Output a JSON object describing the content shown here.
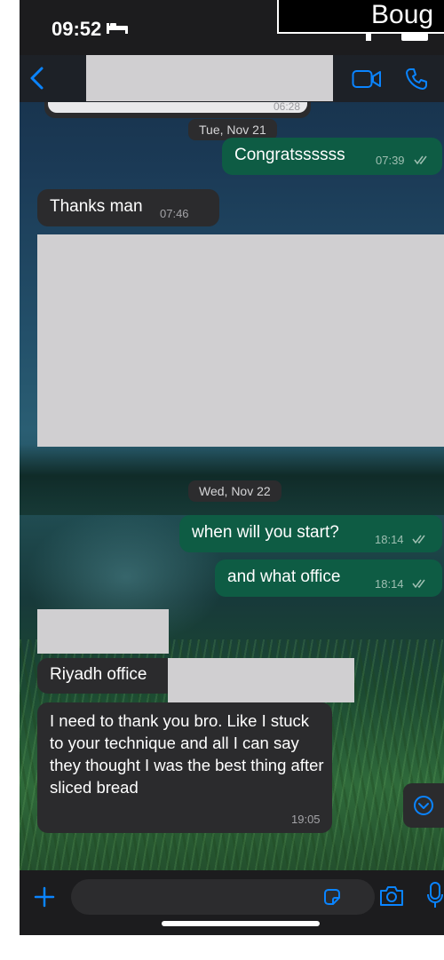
{
  "status_bar": {
    "time": "09:52",
    "caption_text": "Boug"
  },
  "header": {
    "contact_name": ""
  },
  "conversation": {
    "partial_time": "06:28",
    "date_1": "Tue, Nov 21",
    "msg_congrats": {
      "text": "Congratssssss",
      "time": "07:39"
    },
    "msg_thanks": {
      "text": "Thanks man",
      "time": "07:46"
    },
    "date_2": "Wed, Nov 22",
    "msg_when": {
      "text": "when will you start?",
      "time": "18:14"
    },
    "msg_office": {
      "text": "and what office",
      "time": "18:14"
    },
    "msg_riyadh": {
      "text": "Riyadh office"
    },
    "msg_thank_bro": {
      "text": "I need to thank you bro. Like I stuck to your technique and all I can say they thought I was the best thing after sliced bread",
      "time": "19:05"
    }
  },
  "input_bar": {
    "placeholder": ""
  },
  "colors": {
    "outgoing_bubble": "#0e5c44",
    "incoming_bubble": "#2b2b2d",
    "accent_blue": "#0a84ff",
    "redaction": "#d0cfd1"
  },
  "icons": [
    "bed-icon",
    "back-icon",
    "video-call-icon",
    "phone-call-icon",
    "read-receipt-icon",
    "scroll-down-icon",
    "plus-icon",
    "sticker-icon",
    "camera-icon",
    "microphone-icon"
  ]
}
